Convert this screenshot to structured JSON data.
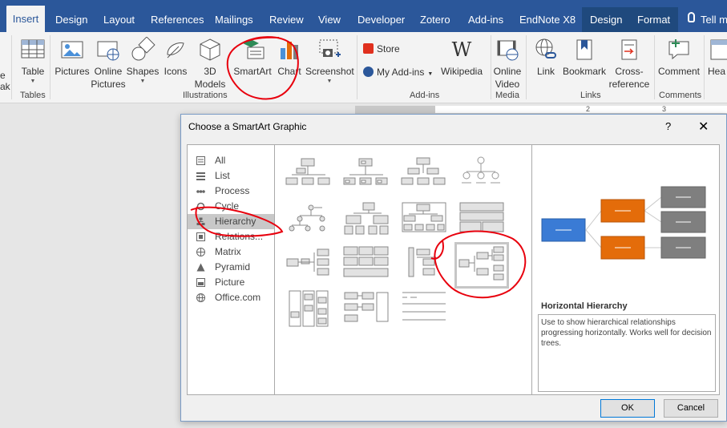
{
  "tabs": [
    {
      "label": "Insert",
      "active": true
    },
    {
      "label": "Design"
    },
    {
      "label": "Layout"
    },
    {
      "label": "References"
    },
    {
      "label": "Mailings"
    },
    {
      "label": "Review"
    },
    {
      "label": "View"
    },
    {
      "label": "Developer"
    },
    {
      "label": "Zotero"
    },
    {
      "label": "Add-ins"
    },
    {
      "label": "EndNote X8"
    },
    {
      "label": "Design",
      "contextual": true
    },
    {
      "label": "Format",
      "contextual": true
    },
    {
      "label": "Tell m"
    }
  ],
  "ribbon": {
    "partial_left": {
      "line1": "e",
      "line2": "ak"
    },
    "table": "Table",
    "tables_group": "Tables",
    "pictures": "Pictures",
    "online_pictures_1": "Online",
    "online_pictures_2": "Pictures",
    "shapes": "Shapes",
    "icons": "Icons",
    "models_1": "3D",
    "models_2": "Models",
    "smartart": "SmartArt",
    "chart": "Chart",
    "screenshot": "Screenshot",
    "illustrations_group": "Illustrations",
    "store": "Store",
    "my_addins": "My Add-ins",
    "wikipedia": "Wikipedia",
    "addins_group": "Add-ins",
    "online_video_1": "Online",
    "online_video_2": "Video",
    "media_group": "Media",
    "link": "Link",
    "bookmark": "Bookmark",
    "cross_ref_1": "Cross-",
    "cross_ref_2": "reference",
    "links_group": "Links",
    "comment": "Comment",
    "comments_group": "Comments",
    "header_partial": "Hea"
  },
  "ruler": {
    "n2": "2",
    "n3": "3"
  },
  "dialog": {
    "title": "Choose a SmartArt Graphic",
    "help": "?",
    "close": "✕",
    "categories": [
      "All",
      "List",
      "Process",
      "Cycle",
      "Hierarchy",
      "Relations...",
      "Matrix",
      "Pyramid",
      "Picture",
      "Office.com"
    ],
    "selected_category": "Hierarchy",
    "preview_title": "Horizontal Hierarchy",
    "preview_description": "Use to show hierarchical relationships progressing horizontally. Works well for decision trees.",
    "ok": "OK",
    "cancel": "Cancel"
  },
  "colors": {
    "tabbar": "#2b579a",
    "preview_blue": "#3a7bd5",
    "preview_orange": "#e46c0a",
    "preview_gray": "#7f7f7f",
    "annotation_red": "#e8000d"
  }
}
